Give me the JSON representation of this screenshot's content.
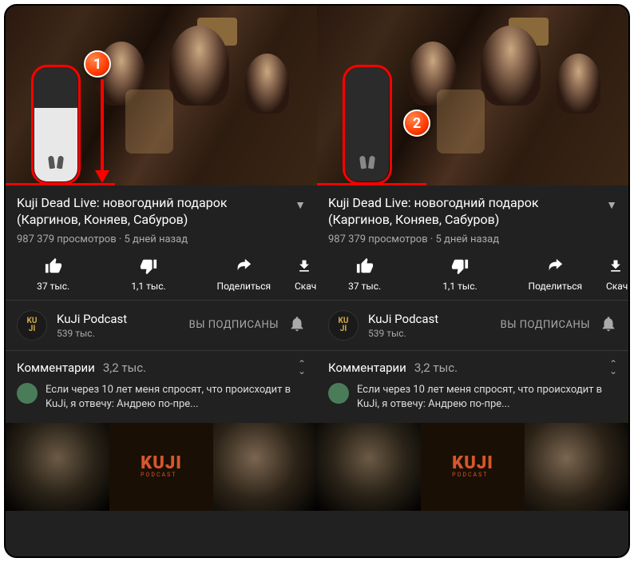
{
  "left": {
    "badge_num": "1",
    "volume_level_pct": 65,
    "video_title": "Kuji Dead Live: новогодний подарок (Каргинов, Коняев, Сабуров)",
    "meta_text": "987 379 просмотров · 5 дней назад",
    "actions": {
      "like_count": "37 тыс.",
      "dislike_count": "1,1 тыс.",
      "share_label": "Поделиться",
      "download_label": "Скач"
    },
    "channel": {
      "avatar_text": "KU\nJI",
      "name": "KuJi Podcast",
      "subs": "539 тыс.",
      "subscribed_label": "ВЫ ПОДПИСАНЫ"
    },
    "comments": {
      "label": "Комментарии",
      "count": "3,2 тыс.",
      "preview_text": "Если через 10 лет меня спросят, что происходит в KuJi, я отвечу: Андрею по-пре..."
    },
    "suggestion_logo": "KUJI",
    "suggestion_logo_sub": "PODCAST"
  },
  "right": {
    "badge_num": "2",
    "volume_level_pct": 0,
    "video_title": "Kuji Dead Live: новогодний подарок (Каргинов, Коняев, Сабуров)",
    "meta_text": "987 379 просмотров · 5 дней назад",
    "actions": {
      "like_count": "37 тыс.",
      "dislike_count": "1,1 тыс.",
      "share_label": "Поделиться",
      "download_label": "Скач"
    },
    "channel": {
      "avatar_text": "KU\nJI",
      "name": "KuJi Podcast",
      "subs": "539 тыс.",
      "subscribed_label": "ВЫ ПОДПИСАНЫ"
    },
    "comments": {
      "label": "Комментарии",
      "count": "3,2 тыс.",
      "preview_text": "Если через 10 лет меня спросят, что происходит в KuJi, я отвечу: Андрею по-пре..."
    },
    "suggestion_logo": "KUJI",
    "suggestion_logo_sub": "PODCAST"
  }
}
